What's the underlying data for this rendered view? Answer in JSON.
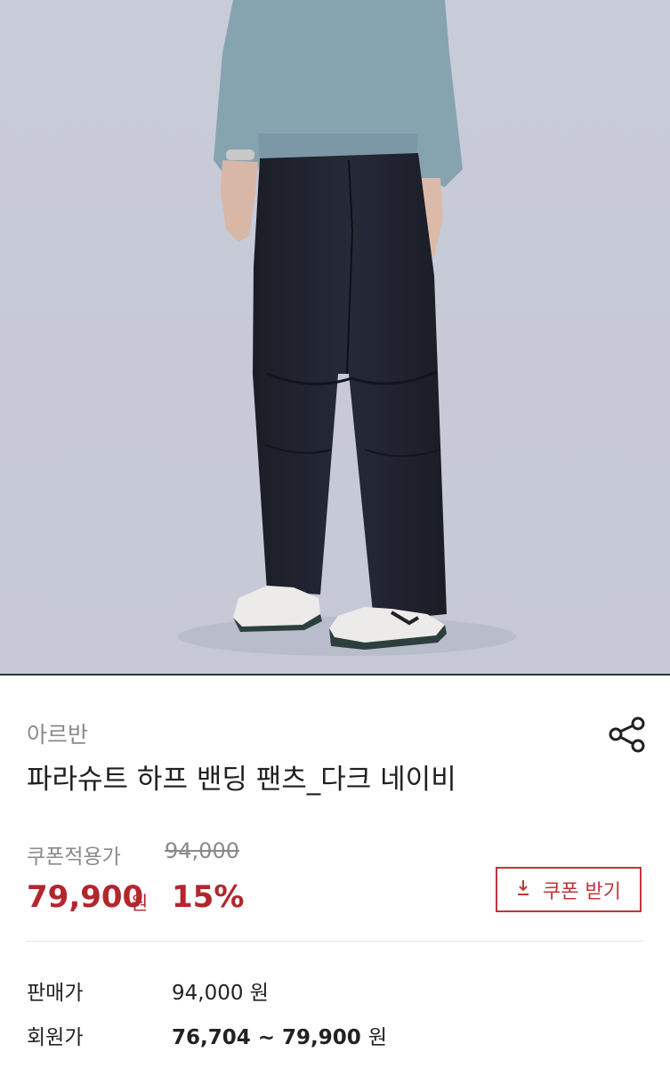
{
  "product": {
    "brand": "아르반",
    "title": "파라슈트 하프 밴딩 팬츠_다크 네이비"
  },
  "pricing": {
    "coupon_label": "쿠폰적용가",
    "original_price": "94,000",
    "sale_price": "79,900",
    "sale_unit": "원",
    "discount": "15%",
    "coupon_button_label": "쿠폰 받기",
    "coupon_button_icon": "download-arrow-icon"
  },
  "details": [
    {
      "label": "판매가",
      "value": "94,000",
      "unit": "원"
    },
    {
      "label": "회원가",
      "value": "76,704 ~ 79,900",
      "unit": "원"
    }
  ],
  "colors": {
    "accent": "#b3262d",
    "muted": "#8a8a8a"
  },
  "icons": {
    "share": "share-icon"
  }
}
